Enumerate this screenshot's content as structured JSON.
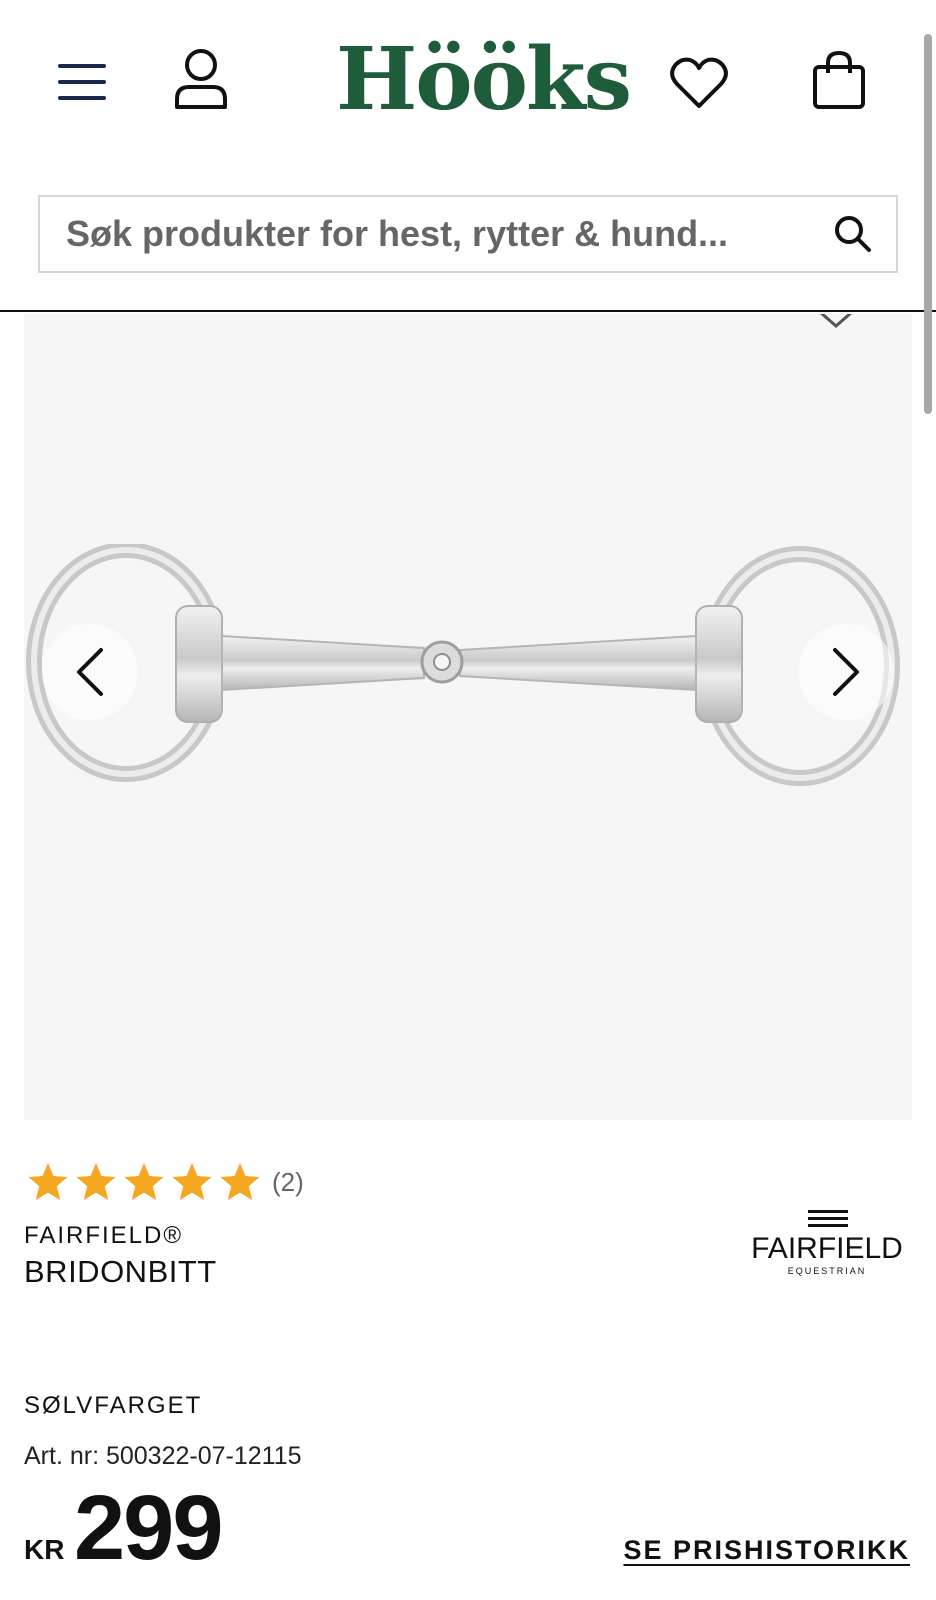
{
  "header": {
    "logo_text": "Hööks",
    "icons": {
      "menu": "hamburger-menu-icon",
      "account": "user-icon",
      "wishlist": "heart-icon",
      "cart": "shopping-bag-icon"
    },
    "brand_color": "#1f5c3a"
  },
  "search": {
    "placeholder": "Søk produkter for hest, rytter & hund...",
    "icon": "search-icon"
  },
  "gallery": {
    "image": "eggbutt-snaffle-bit-image",
    "prev_icon": "chevron-left-icon",
    "next_icon": "chevron-right-icon"
  },
  "product": {
    "rating_value": 5,
    "rating_max": 5,
    "rating_count": "(2)",
    "brand": "FAIRFIELD®",
    "name": "BRIDONBITT",
    "brand_logo_text": "FAIRFIELD",
    "brand_logo_subtext": "EQUESTRIAN",
    "color": "SØLVFARGET",
    "article_number": "Art. nr: 500322-07-12115",
    "currency": "KR",
    "price": "299",
    "price_history_link": "SE PRISHISTORIKK",
    "star_color": "#f5a623"
  }
}
